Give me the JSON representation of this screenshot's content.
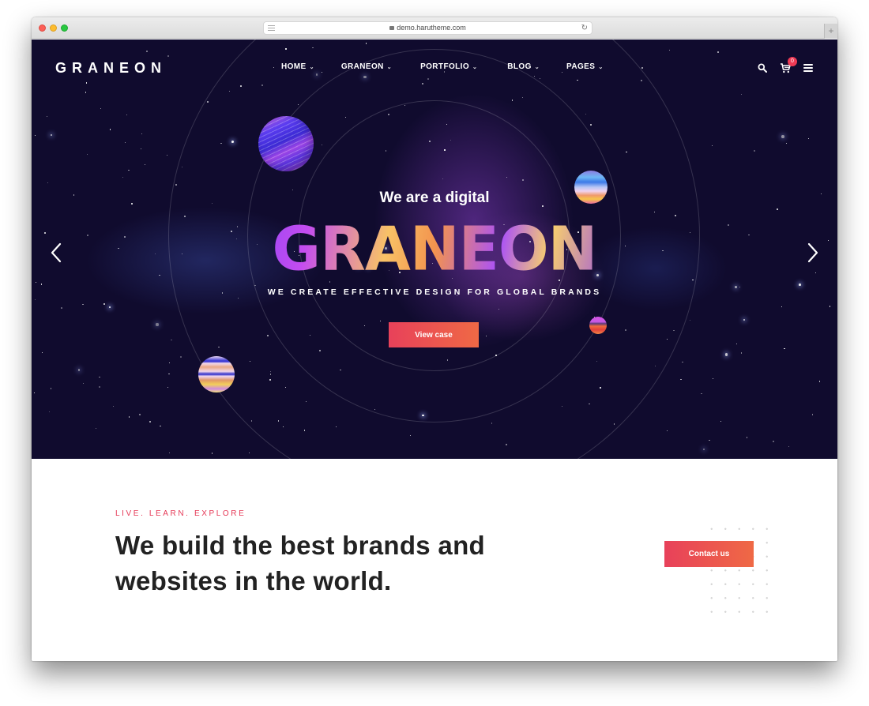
{
  "browser": {
    "url": "demo.harutheme.com",
    "new_tab_label": "+"
  },
  "header": {
    "logo": "GRANEON",
    "nav": [
      {
        "label": "HOME",
        "has_dropdown": true
      },
      {
        "label": "GRANEON",
        "has_dropdown": true
      },
      {
        "label": "PORTFOLIO",
        "has_dropdown": true
      },
      {
        "label": "BLOG",
        "has_dropdown": true
      },
      {
        "label": "PAGES",
        "has_dropdown": true
      }
    ],
    "cart_count": "0",
    "icons": [
      "search-icon",
      "cart-icon",
      "hamburger-menu-icon"
    ]
  },
  "hero": {
    "subtitle": "We are a digital",
    "title": "GRANEON",
    "tagline": "WE CREATE EFFECTIVE DESIGN FOR GLOBAL BRANDS",
    "cta_label": "View case",
    "prev_arrow": "‹",
    "next_arrow": "›"
  },
  "intro": {
    "eyebrow": "LIVE. LEARN. EXPLORE",
    "headline_line1": "We build the best brands and",
    "headline_line2": "websites in the world.",
    "cta_label": "Contact us"
  },
  "colors": {
    "accent_start": "#e8415a",
    "accent_end": "#ef6945",
    "hero_bg": "#100b2e",
    "eyebrow": "#e53755",
    "headline": "#222222"
  }
}
